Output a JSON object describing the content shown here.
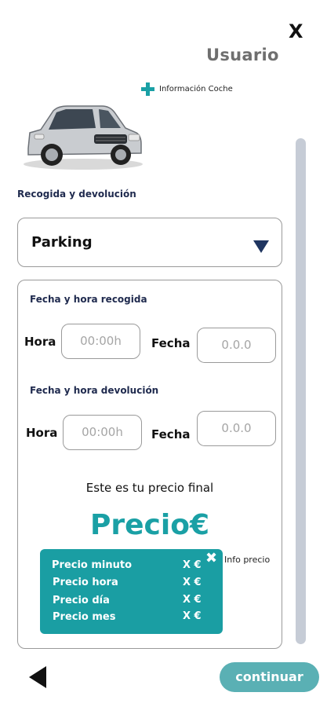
{
  "header": {
    "close_label": "X",
    "title": "Usuario",
    "info_cache_label": "Información Coche"
  },
  "icons": {
    "close": "close-icon",
    "plus": "plus-icon",
    "chevron": "chevron-down-icon",
    "back": "back-arrow-icon",
    "info_close": "close-icon"
  },
  "colors": {
    "accent": "#1aa0a5",
    "navy": "#1f2a4e",
    "continue_button": "#5ab0b4"
  },
  "pickup_return": {
    "section_label": "Recogida y devolución",
    "location_value": "Parking"
  },
  "pickup": {
    "label": "Fecha y hora recogida",
    "hour_label": "Hora",
    "hour_value": "00:00h",
    "date_label": "Fecha",
    "date_value": "0.0.0"
  },
  "return": {
    "label": "Fecha y hora devolución",
    "hour_label": "Hora",
    "hour_value": "00:00h",
    "date_label": "Fecha",
    "date_value": "0.0.0"
  },
  "price": {
    "final_text": "Este es tu precio final",
    "value": "Precio€",
    "info_link": "Info precio",
    "breakdown": [
      {
        "label": "Precio minuto",
        "value": "X €"
      },
      {
        "label": "Precio hora",
        "value": "X €"
      },
      {
        "label": "Precio día",
        "value": "X €"
      },
      {
        "label": "Precio mes",
        "value": "X €"
      }
    ]
  },
  "footer": {
    "continue_label": "continuar"
  }
}
